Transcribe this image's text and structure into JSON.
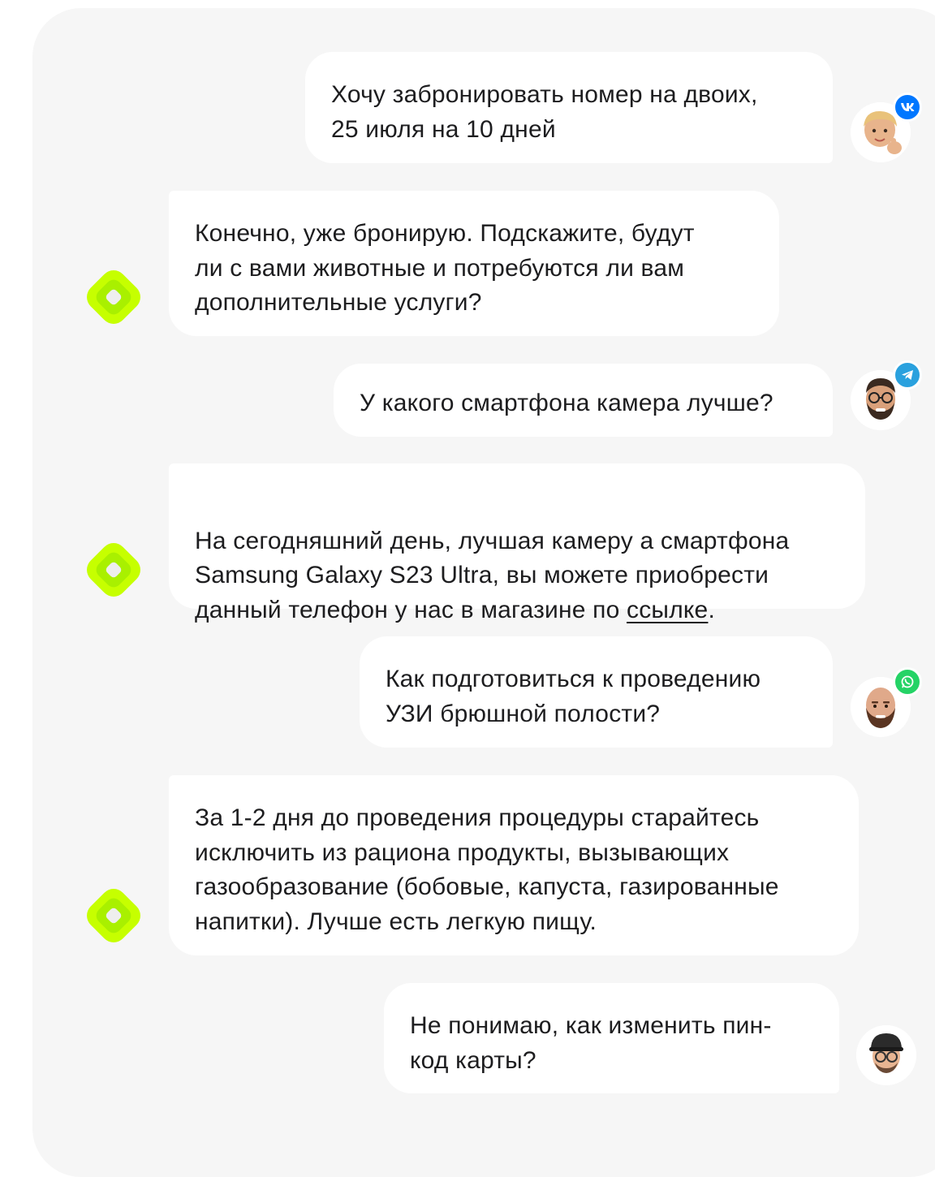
{
  "messages": [
    {
      "role": "user",
      "text": "Хочу забронировать номер на двоих,\n25 июля на 10 дней",
      "messenger": "vk",
      "messenger_badge": "vk-icon"
    },
    {
      "role": "bot",
      "text": "Конечно, уже бронирую. Подскажите, будут\nли с вами животные и потребуются ли вам\nдополнительные услуги?"
    },
    {
      "role": "user",
      "text": "У какого смартфона камера лучше?",
      "messenger": "telegram",
      "messenger_badge": "telegram-icon"
    },
    {
      "role": "bot",
      "text_before_link": "На сегодняшний день,  лучшая камеру а смартфона\nSamsung Galaxy S23 Ultra, вы можете приобрести\nданный телефон у нас в магазине по ",
      "link_text": "ссылке",
      "text_after_link": "."
    },
    {
      "role": "user",
      "text": "Как подготовиться к проведению\nУЗИ брюшной полости?",
      "messenger": "whatsapp",
      "messenger_badge": "whatsapp-icon"
    },
    {
      "role": "bot",
      "text": "За 1-2 дня до проведения процедуры старайтесь\nисключить из рациона продукты, вызывающих\nгазообразование (бобовые, капуста, газированные\nнапитки). Лучше есть легкую пищу."
    },
    {
      "role": "user",
      "text": "Не понимаю, как изменить пин-\nкод карты?"
    }
  ],
  "colors": {
    "panel_bg": "#f6f6f6",
    "bubble_bg": "#ffffff",
    "bot_logo_outer": "#c6ff00",
    "bot_logo_mid": "#a9f000",
    "vk": "#0077ff",
    "telegram": "#2aa1de",
    "whatsapp": "#25d366"
  },
  "icons": {
    "bot": "bot-logo-icon",
    "vk": "vk-icon",
    "telegram": "telegram-icon",
    "whatsapp": "whatsapp-icon"
  }
}
